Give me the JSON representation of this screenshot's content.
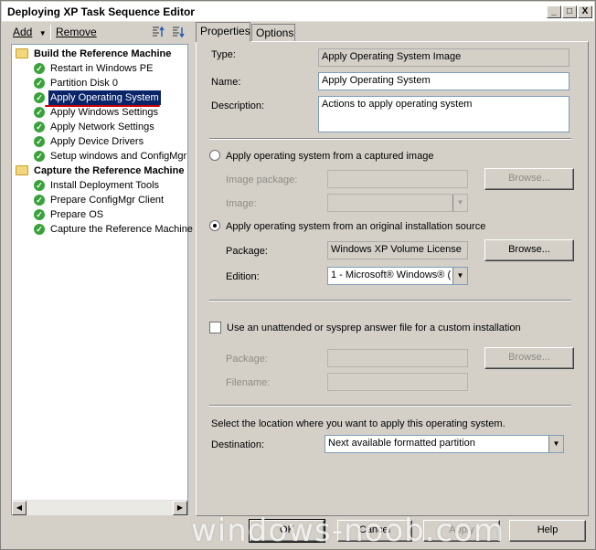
{
  "window": {
    "title": "Deploying XP Task Sequence Editor",
    "controls": [
      "_",
      "□",
      "X"
    ]
  },
  "toolbar": {
    "add_label": "Add",
    "remove_label": "Remove",
    "icons": [
      "move-up-icon",
      "move-down-icon"
    ]
  },
  "tree": {
    "groups": [
      {
        "label": "Build the Reference Machine",
        "icon": "folder-icon",
        "items": [
          "Restart in Windows PE",
          "Partition Disk 0",
          "Apply Operating System",
          "Apply Windows Settings",
          "Apply Network Settings",
          "Apply Device Drivers",
          "Setup windows and ConfigMgr"
        ]
      },
      {
        "label": "Capture the Reference Machine",
        "icon": "folder-icon",
        "items": [
          "Install Deployment Tools",
          "Prepare ConfigMgr Client",
          "Prepare OS",
          "Capture the Reference Machine"
        ]
      }
    ],
    "selected": "Apply Operating System",
    "item_icon": "success-check-icon"
  },
  "tabs": [
    "Properties",
    "Options"
  ],
  "properties": {
    "type_label": "Type:",
    "type_value": "Apply Operating System Image",
    "name_label": "Name:",
    "name_value": "Apply Operating System",
    "description_label": "Description:",
    "description_value": "Actions to apply operating system",
    "radio_captured": "Apply operating system from a captured image",
    "image_package_label": "Image package:",
    "image_label": "Image:",
    "browse_label": "Browse...",
    "radio_original": "Apply operating system from an original installation source",
    "package_label": "Package:",
    "package_value": "Windows XP Volume License",
    "edition_label": "Edition:",
    "edition_value": "1 - Microsoft® Windows® (",
    "answer_file_label": "Use an unattended or sysprep answer file for a custom installation",
    "answer_package_label": "Package:",
    "filename_label": "Filename:",
    "location_text": "Select the location where you want to apply this operating system.",
    "destination_label": "Destination:",
    "destination_value": "Next available formatted partition"
  },
  "footer": {
    "ok": "OK",
    "cancel": "Cancel",
    "apply": "Apply",
    "help": "Help"
  },
  "watermark": "windows-noob.com"
}
